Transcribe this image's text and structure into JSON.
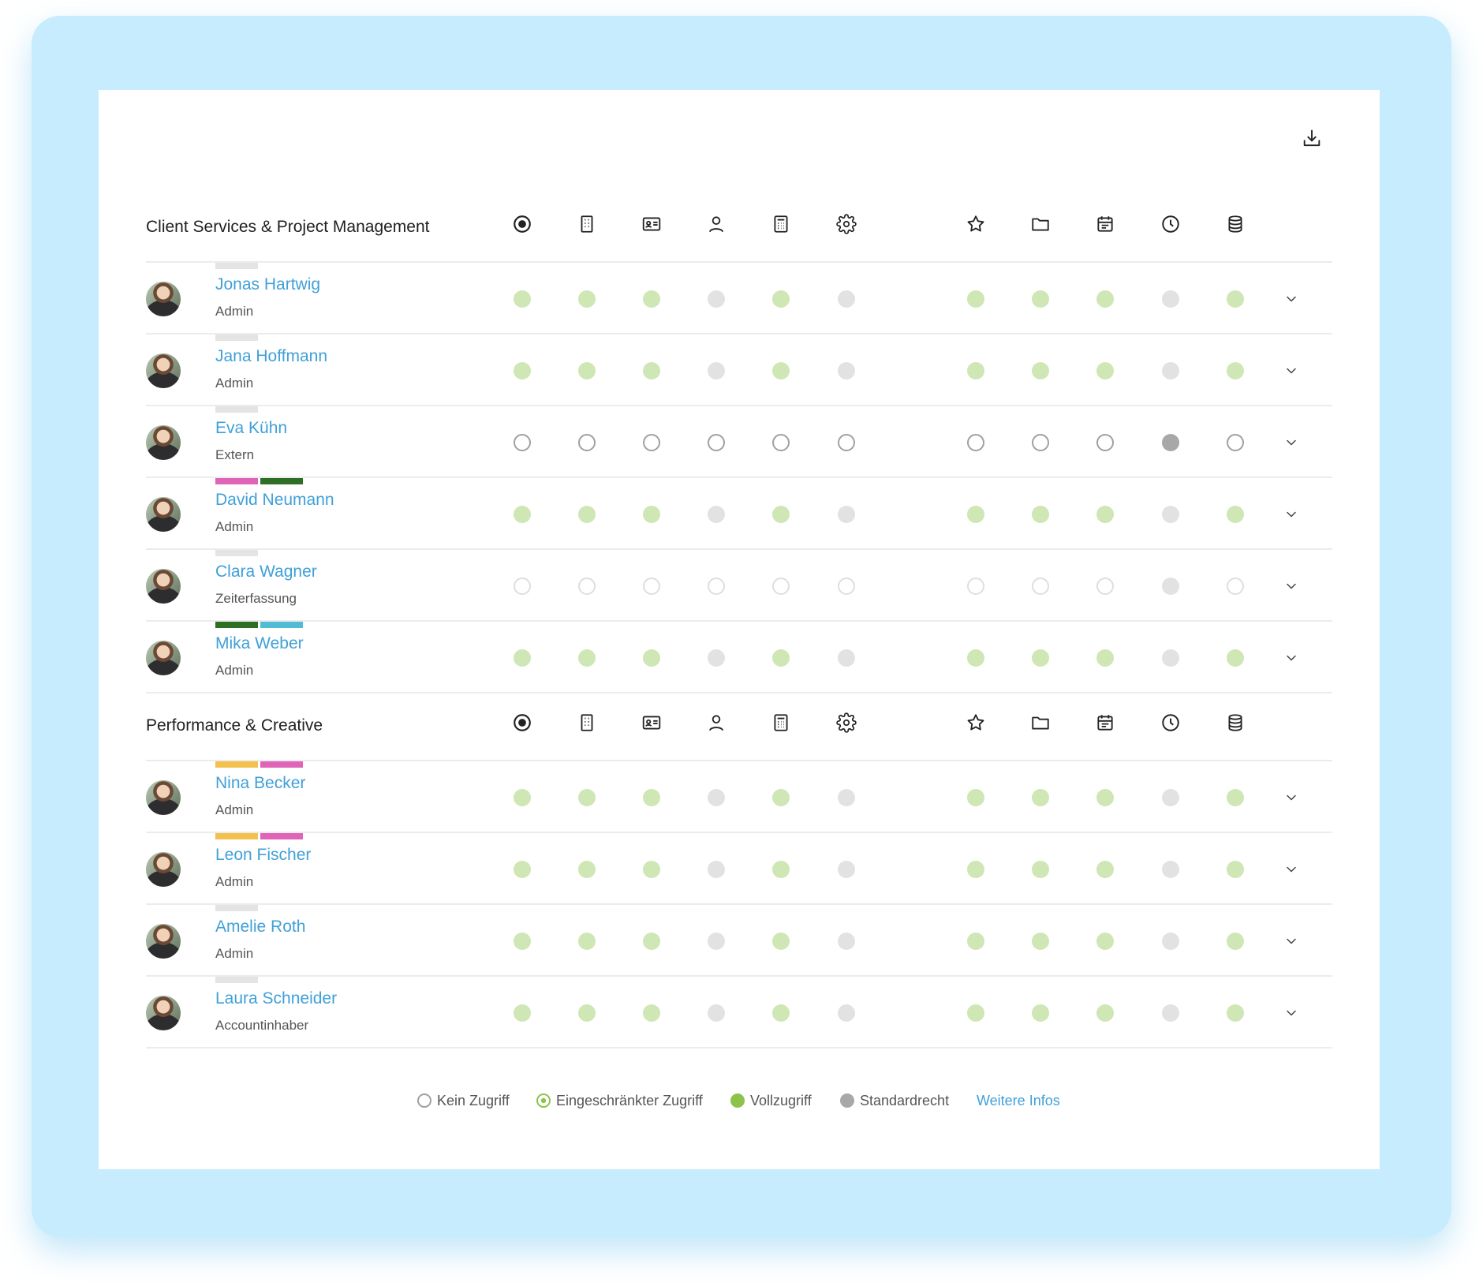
{
  "colors": {
    "frame": "#c6ecfd",
    "link": "#3fa0d8",
    "full_access": "#cfe6b5",
    "standard": "#e2e2e2",
    "legend_green": "#8cc34b",
    "legend_grey": "#a8a8a8",
    "tag_grey": "#e4e4e4",
    "tag_pink": "#e064b8",
    "tag_darkgreen": "#2e6e25",
    "tag_cyan": "#52bcd6",
    "tag_yellow": "#f2c14e"
  },
  "columns": [
    "target-icon",
    "building-icon",
    "id-card-icon",
    "user-icon",
    "calculator-icon",
    "gear-icon",
    "star-icon",
    "folder-icon",
    "calendar-icon",
    "clock-icon",
    "database-icon"
  ],
  "sections": [
    {
      "title": "Client Services & Project Management",
      "members": [
        {
          "name": "Jonas Hartwig",
          "role": "Admin",
          "tags": [
            "tag_grey"
          ],
          "access": [
            "full",
            "full",
            "full",
            "std",
            "full",
            "std",
            "full",
            "full",
            "full",
            "std",
            "full"
          ]
        },
        {
          "name": "Jana Hoffmann",
          "role": "Admin",
          "tags": [
            "tag_grey"
          ],
          "access": [
            "full",
            "full",
            "full",
            "std",
            "full",
            "std",
            "full",
            "full",
            "full",
            "std",
            "full"
          ]
        },
        {
          "name": "Eva Kühn",
          "role": "Extern",
          "tags": [
            "tag_grey"
          ],
          "access": [
            "none",
            "none",
            "none",
            "none",
            "none",
            "none",
            "none",
            "none",
            "none",
            "std-dark",
            "none"
          ]
        },
        {
          "name": "David Neumann",
          "role": "Admin",
          "tags": [
            "tag_pink",
            "tag_darkgreen"
          ],
          "access": [
            "full",
            "full",
            "full",
            "std",
            "full",
            "std",
            "full",
            "full",
            "full",
            "std",
            "full"
          ]
        },
        {
          "name": "Clara Wagner",
          "role": "Zeiterfassung",
          "tags": [
            "tag_grey"
          ],
          "access": [
            "none-light",
            "none-light",
            "none-light",
            "none-light",
            "none-light",
            "none-light",
            "none-light",
            "none-light",
            "none-light",
            "std",
            "none-light"
          ]
        },
        {
          "name": "Mika Weber",
          "role": "Admin",
          "tags": [
            "tag_darkgreen",
            "tag_cyan"
          ],
          "access": [
            "full",
            "full",
            "full",
            "std",
            "full",
            "std",
            "full",
            "full",
            "full",
            "std",
            "full"
          ]
        }
      ]
    },
    {
      "title": "Performance & Creative",
      "members": [
        {
          "name": "Nina Becker",
          "role": "Admin",
          "tags": [
            "tag_yellow",
            "tag_pink"
          ],
          "access": [
            "full",
            "full",
            "full",
            "std",
            "full",
            "std",
            "full",
            "full",
            "full",
            "std",
            "full"
          ]
        },
        {
          "name": "Leon Fischer",
          "role": "Admin",
          "tags": [
            "tag_yellow",
            "tag_pink"
          ],
          "access": [
            "full",
            "full",
            "full",
            "std",
            "full",
            "std",
            "full",
            "full",
            "full",
            "std",
            "full"
          ]
        },
        {
          "name": "Amelie Roth",
          "role": "Admin",
          "tags": [
            "tag_grey"
          ],
          "access": [
            "full",
            "full",
            "full",
            "std",
            "full",
            "std",
            "full",
            "full",
            "full",
            "std",
            "full"
          ]
        },
        {
          "name": "Laura Schneider",
          "role": "Accountinhaber",
          "tags": [
            "tag_grey"
          ],
          "access": [
            "full",
            "full",
            "full",
            "std",
            "full",
            "std",
            "full",
            "full",
            "full",
            "std",
            "full"
          ]
        }
      ]
    }
  ],
  "legend": {
    "none": "Kein Zugriff",
    "limited": "Eingeschränkter Zugriff",
    "full": "Vollzugriff",
    "standard": "Standardrecht",
    "more_link": "Weitere Infos"
  }
}
